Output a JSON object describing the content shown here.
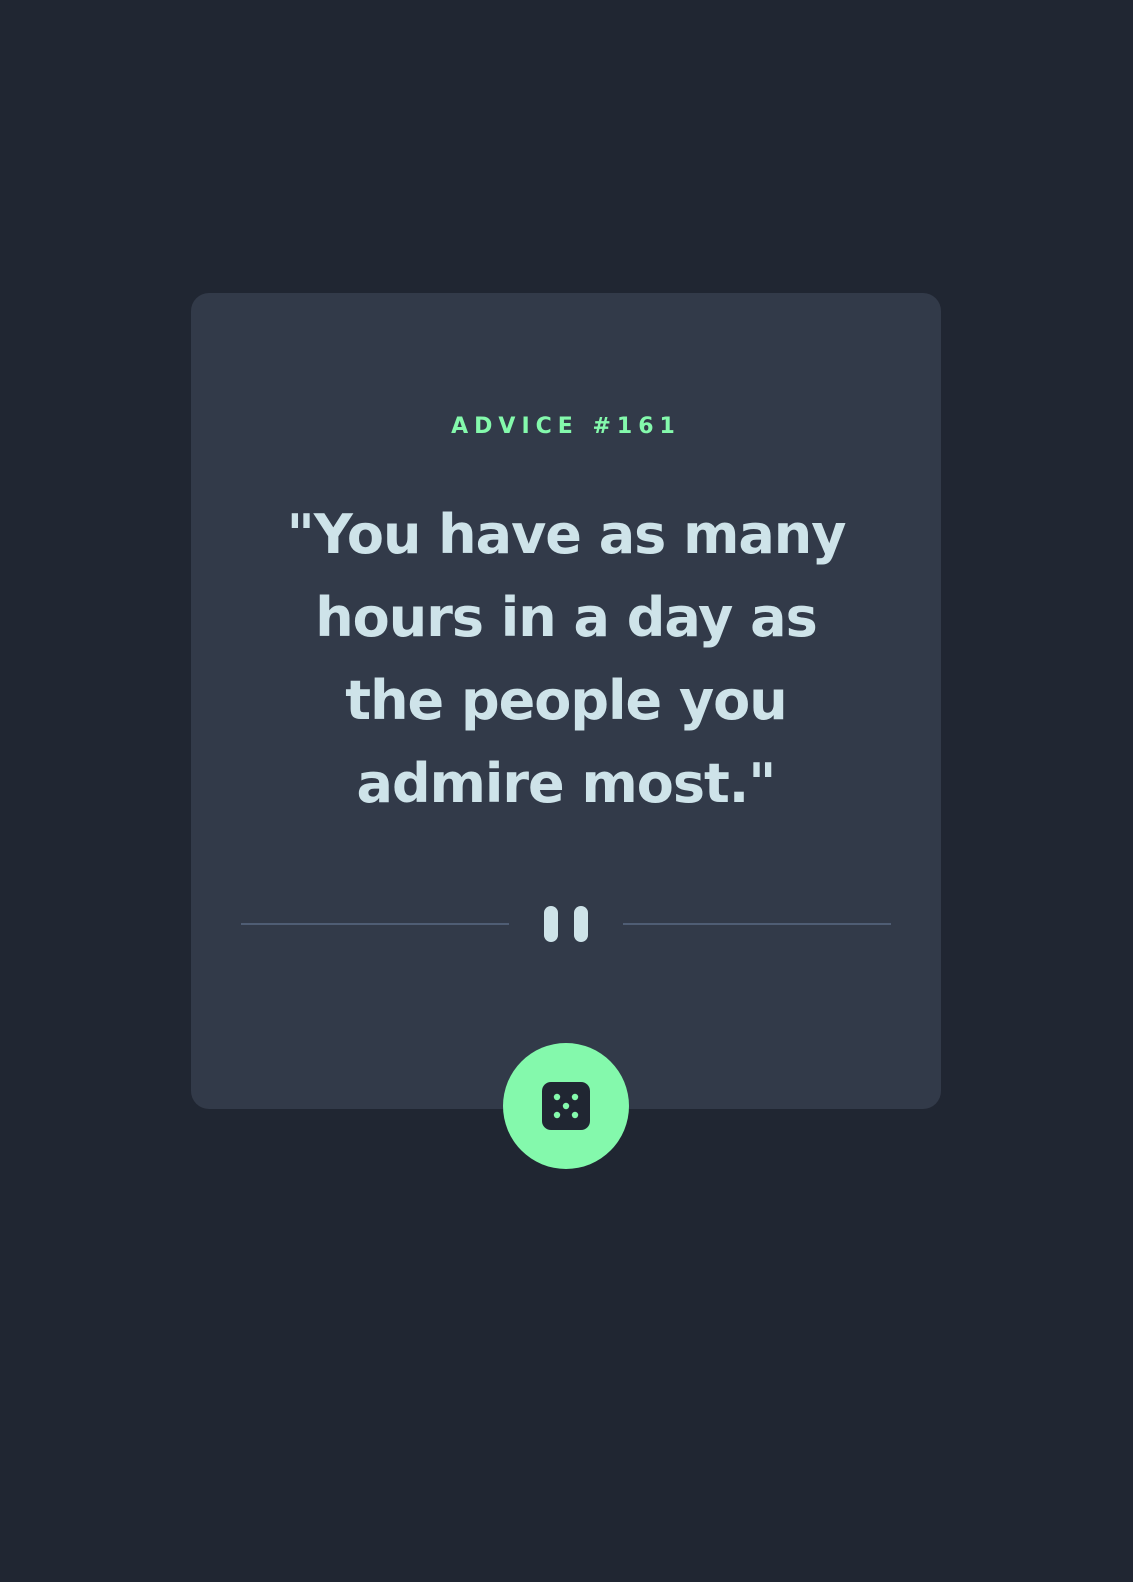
{
  "advice": {
    "id_label": "ADVICE #161",
    "quote": "\"You have as many hours in a day as the people you admire most.\""
  },
  "divider": {
    "icon": "pause-icon"
  },
  "button": {
    "icon": "dice-icon"
  },
  "colors": {
    "background": "#202632",
    "card": "#323a49",
    "accent": "#84f9ac",
    "text": "#cee3e9",
    "divider": "#4f5d74"
  }
}
